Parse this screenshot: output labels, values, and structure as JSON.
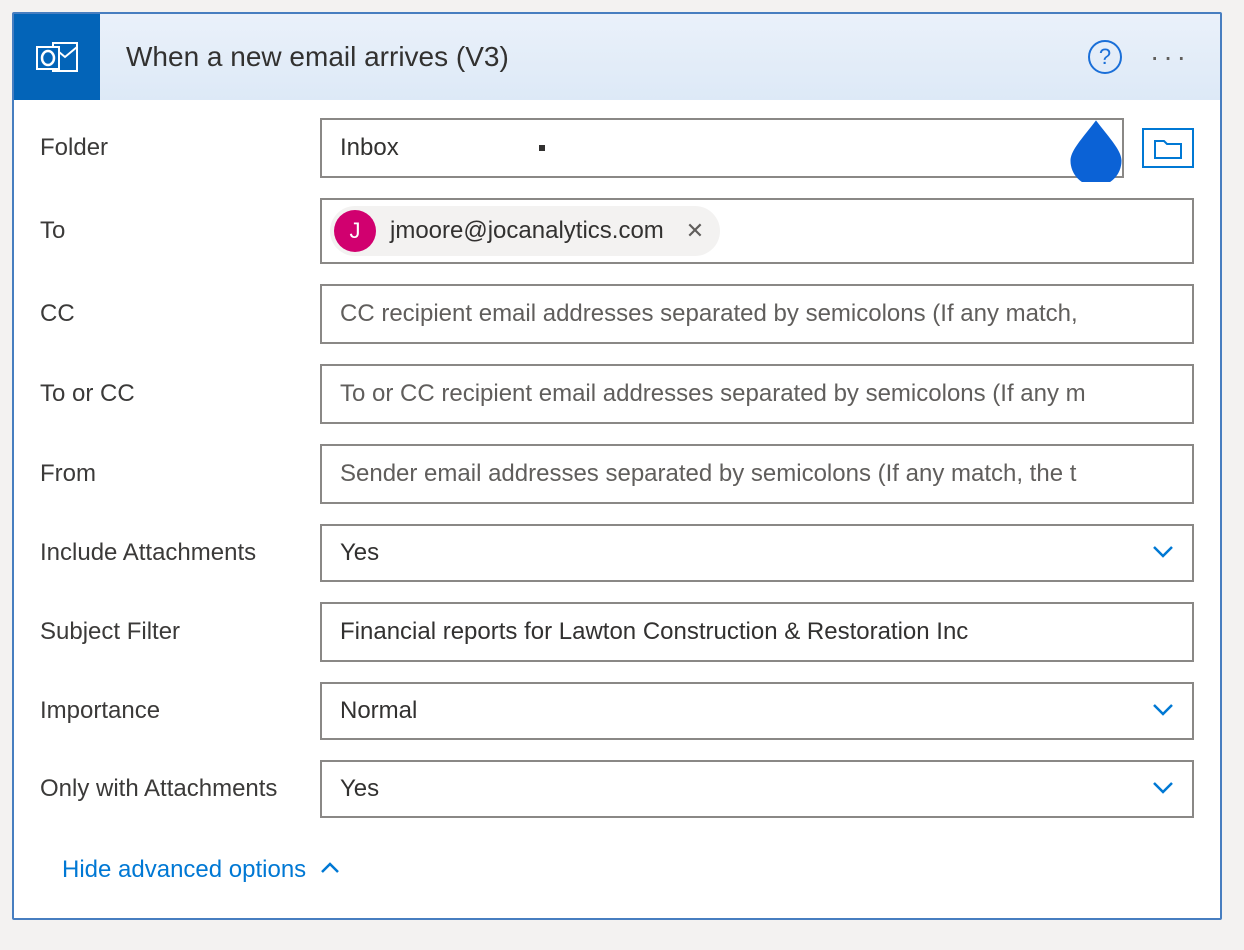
{
  "header": {
    "title": "When a new email arrives (V3)",
    "app_icon_name": "outlook"
  },
  "fields": {
    "folder": {
      "label": "Folder",
      "value": "Inbox"
    },
    "to": {
      "label": "To",
      "token_initial": "J",
      "token_email": "jmoore@jocanalytics.com"
    },
    "cc": {
      "label": "CC",
      "placeholder": "CC recipient email addresses separated by semicolons (If any match,"
    },
    "toOrCc": {
      "label": "To or CC",
      "placeholder": "To or CC recipient email addresses separated by semicolons (If any m"
    },
    "from": {
      "label": "From",
      "placeholder": "Sender email addresses separated by semicolons (If any match, the t"
    },
    "includeAttachments": {
      "label": "Include Attachments",
      "value": "Yes"
    },
    "subjectFilter": {
      "label": "Subject Filter",
      "value": "Financial reports for Lawton Construction & Restoration Inc"
    },
    "importance": {
      "label": "Importance",
      "value": "Normal"
    },
    "onlyWithAttachments": {
      "label": "Only with Attachments",
      "value": "Yes"
    }
  },
  "footer": {
    "hide_label": "Hide advanced options"
  }
}
